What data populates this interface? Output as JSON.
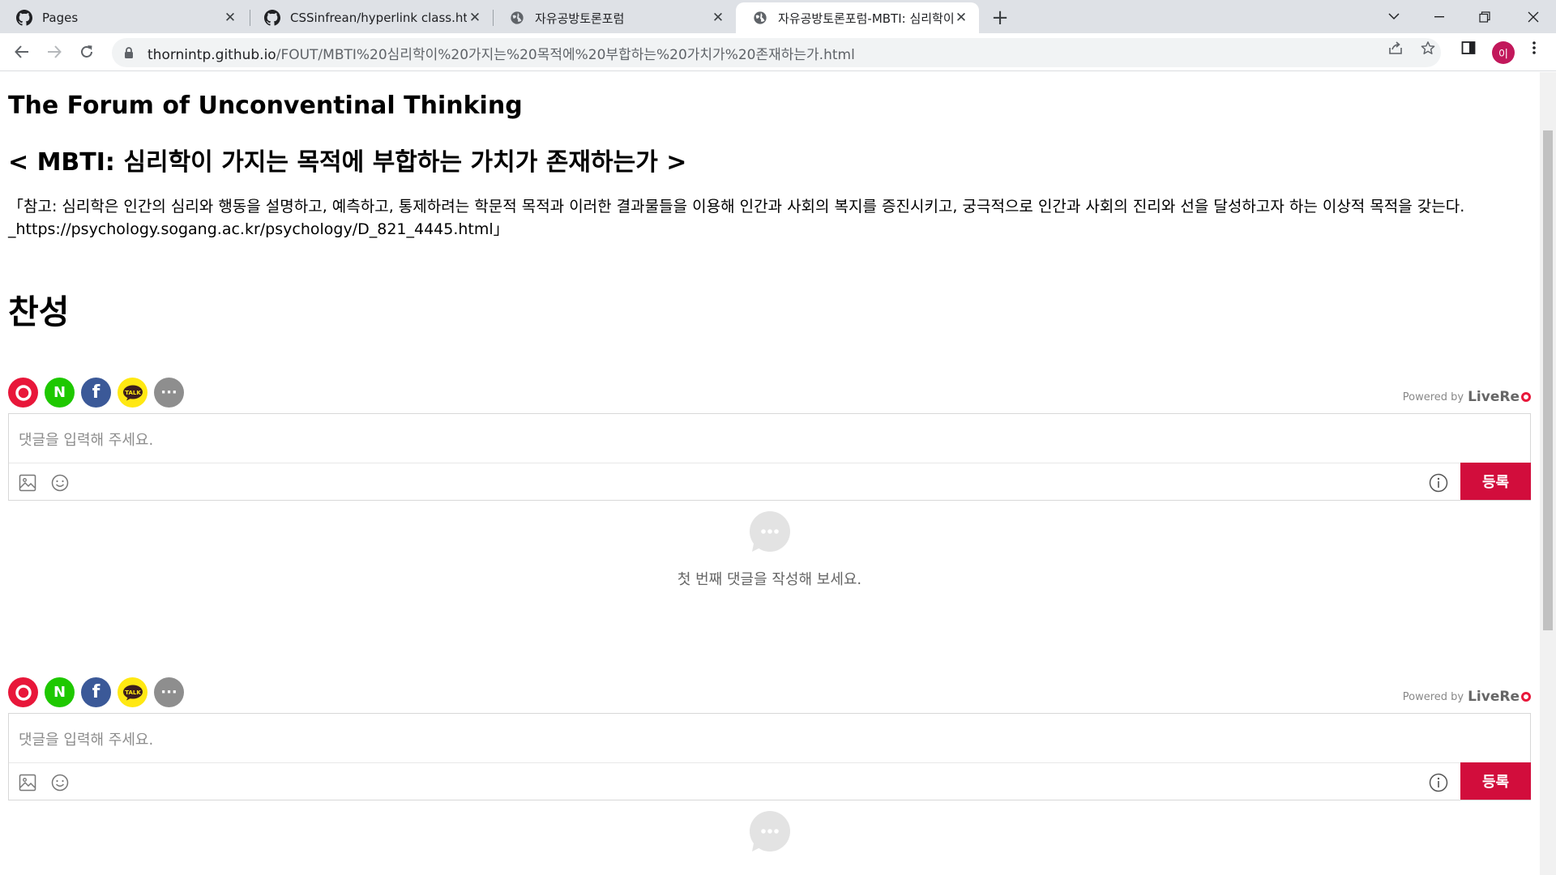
{
  "tabs": [
    {
      "title": "Pages",
      "icon": "github-icon",
      "active": false
    },
    {
      "title": "CSSinfrean/hyperlink class.html",
      "icon": "github-icon",
      "active": false
    },
    {
      "title": "자유공방토론포럼",
      "icon": "globe-icon",
      "active": false
    },
    {
      "title": "자유공방토론포럼-MBTI: 심리학이",
      "icon": "globe-icon",
      "active": true
    }
  ],
  "address_bar": {
    "host": "thornintp.github.io",
    "path": "/FOUT/MBTI%20심리학이%20가지는%20목적에%20부합하는%20가치가%20존재하는가.html"
  },
  "profile_initial": "이",
  "page": {
    "site_title": "The Forum of Unconventinal Thinking",
    "topic_title": "< MBTI: 심리학이 가지는 목적에 부합하는 가치가 존재하는가 >",
    "note": "「참고: 심리학은 인간의 심리와 행동을 설명하고, 예측하고, 통제하려는 학문적 목적과 이러한 결과물들을 이용해 인간과 사회의 복지를 증진시키고, 궁극적으로 인간과 사회의 진리와 선을 달성하고자 하는 이상적 목적을 갖는다. _https://psychology.sogang.ac.kr/psychology/D_821_4445.html」",
    "section_heading": "찬성"
  },
  "comments": {
    "powered_by": "Powered by",
    "brand": "LiveRe",
    "placeholder": "댓글을 입력해 주세요.",
    "submit_label": "등록",
    "empty_message": "첫 번째 댓글을 작성해 보세요.",
    "sns": [
      {
        "name": "livere-login",
        "label": "",
        "color": "#e8173a"
      },
      {
        "name": "naver-login",
        "label": "N",
        "color": "#1ec800"
      },
      {
        "name": "facebook-login",
        "label": "f",
        "color": "#3b5998"
      },
      {
        "name": "kakao-login",
        "label": "TALK",
        "color": "#ffe812"
      },
      {
        "name": "more-login",
        "label": "···",
        "color": "#8e8e8e"
      }
    ],
    "accent_color": "#d20d3c"
  }
}
